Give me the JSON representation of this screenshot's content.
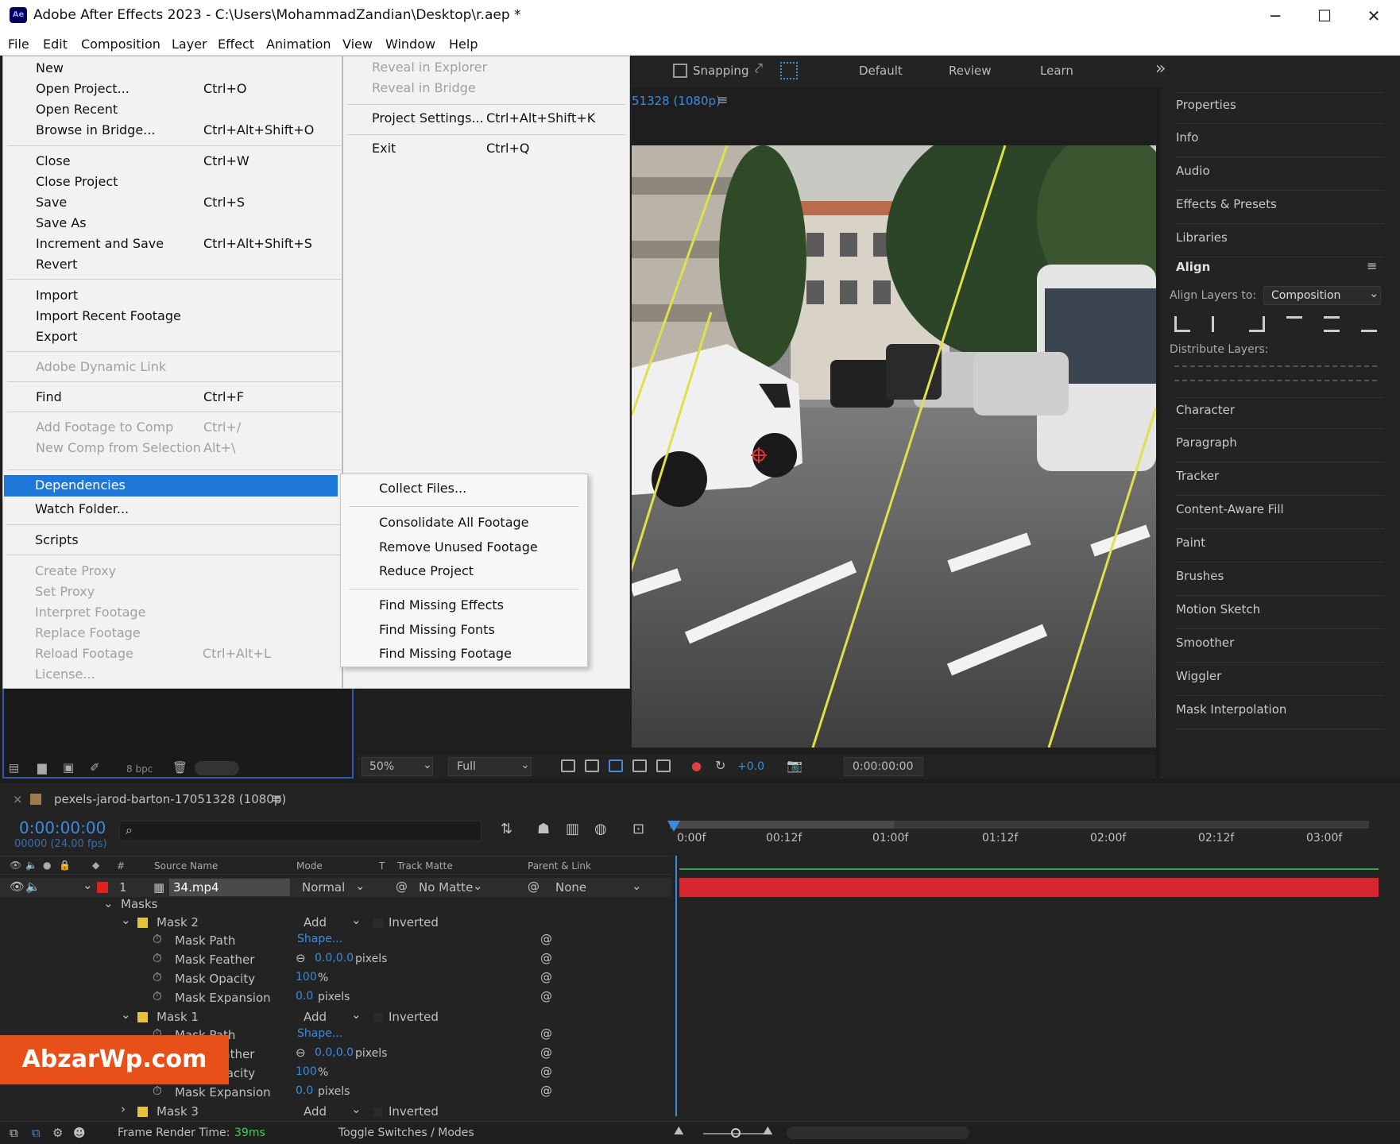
{
  "window": {
    "title": "Adobe After Effects 2023 - C:\\Users\\MohammadZandian\\Desktop\\r.aep *",
    "app_icon": "Ae",
    "minimize": "─",
    "maximize": "☐",
    "close": "✕"
  },
  "menubar": [
    "File",
    "Edit",
    "Composition",
    "Layer",
    "Effect",
    "Animation",
    "View",
    "Window",
    "Help"
  ],
  "file_menu": {
    "items": [
      {
        "label": "New",
        "shortcut": ""
      },
      {
        "label": "Open Project...",
        "shortcut": "Ctrl+O"
      },
      {
        "label": "Open Recent",
        "shortcut": ""
      },
      {
        "label": "Browse in Bridge...",
        "shortcut": "Ctrl+Alt+Shift+O"
      },
      {
        "label": "Close",
        "shortcut": "Ctrl+W"
      },
      {
        "label": "Close Project",
        "shortcut": ""
      },
      {
        "label": "Save",
        "shortcut": "Ctrl+S"
      },
      {
        "label": "Save As",
        "shortcut": ""
      },
      {
        "label": "Increment and Save",
        "shortcut": "Ctrl+Alt+Shift+S"
      },
      {
        "label": "Revert",
        "shortcut": ""
      },
      {
        "label": "Import",
        "shortcut": ""
      },
      {
        "label": "Import Recent Footage",
        "shortcut": ""
      },
      {
        "label": "Export",
        "shortcut": ""
      },
      {
        "label": "Adobe Dynamic Link",
        "shortcut": ""
      },
      {
        "label": "Find",
        "shortcut": "Ctrl+F"
      },
      {
        "label": "Add Footage to Comp",
        "shortcut": "Ctrl+/"
      },
      {
        "label": "New Comp from Selection",
        "shortcut": "Alt+\\"
      },
      {
        "label": "Dependencies",
        "shortcut": ""
      },
      {
        "label": "Watch Folder...",
        "shortcut": ""
      },
      {
        "label": "Scripts",
        "shortcut": ""
      },
      {
        "label": "Create Proxy",
        "shortcut": ""
      },
      {
        "label": "Set Proxy",
        "shortcut": ""
      },
      {
        "label": "Interpret Footage",
        "shortcut": ""
      },
      {
        "label": "Replace Footage",
        "shortcut": ""
      },
      {
        "label": "Reload Footage",
        "shortcut": "Ctrl+Alt+L"
      },
      {
        "label": "License...",
        "shortcut": ""
      }
    ],
    "col2": [
      {
        "label": "Reveal in Explorer",
        "shortcut": ""
      },
      {
        "label": "Reveal in Bridge",
        "shortcut": ""
      },
      {
        "label": "Project Settings...",
        "shortcut": "Ctrl+Alt+Shift+K"
      },
      {
        "label": "Exit",
        "shortcut": "Ctrl+Q"
      }
    ]
  },
  "dependencies_submenu": [
    "Collect Files...",
    "Consolidate All Footage",
    "Remove Unused Footage",
    "Reduce Project",
    "Find Missing Effects",
    "Find Missing Fonts",
    "Find Missing Footage"
  ],
  "toolbar": {
    "snapping": "Snapping",
    "workspaces": [
      "Default",
      "Review",
      "Learn"
    ],
    "more": "»"
  },
  "composition": {
    "tab_partial": "51328 (1080p)",
    "zoom": "50%",
    "resolution": "Full",
    "exposure": "+0.0",
    "timecode": "0:00:00:00"
  },
  "right_panels": [
    "Properties",
    "Info",
    "Audio",
    "Effects & Presets",
    "Libraries"
  ],
  "align": {
    "title": "Align",
    "align_to_label": "Align Layers to:",
    "align_to_value": "Composition",
    "distribute_label": "Distribute Layers:"
  },
  "right_panels_2": [
    "Character",
    "Paragraph",
    "Tracker",
    "Content-Aware Fill",
    "Paint",
    "Brushes",
    "Motion Sketch",
    "Smoother",
    "Wiggler",
    "Mask Interpolation"
  ],
  "project_panel": {
    "bpc": "8 bpc"
  },
  "timeline": {
    "comp_name": "pexels-jarod-barton-17051328 (1080p)",
    "timecode": "0:00:00:00",
    "frames": "00000 (24.00 fps)",
    "search_glyph": "⌕",
    "col_headers": {
      "num": "#",
      "source": "Source Name",
      "mode": "Mode",
      "t": "T",
      "track_matte": "Track Matte",
      "parent": "Parent & Link"
    },
    "ruler": [
      "0:00f",
      "00:12f",
      "01:00f",
      "01:12f",
      "02:00f",
      "02:12f",
      "03:00f"
    ],
    "layer": {
      "num": "1",
      "name": "34.mp4",
      "mode": "Normal",
      "matte": "No Matte",
      "parent": "None"
    },
    "masks_label": "Masks",
    "mask2": {
      "name": "Mask 2",
      "mode": "Add",
      "inverted": "Inverted",
      "path_label": "Mask Path",
      "path_value": "Shape...",
      "feather_label": "Mask Feather",
      "feather_value": "0.0,0.0",
      "feather_unit": "pixels",
      "opacity_label": "Mask Opacity",
      "opacity_value": "100",
      "opacity_unit": "%",
      "expansion_label": "Mask Expansion",
      "expansion_value": "0.0",
      "expansion_unit": "pixels"
    },
    "mask1": {
      "name": "Mask 1",
      "mode": "Add",
      "inverted": "Inverted",
      "path_label": "Mask Path",
      "path_value": "Shape...",
      "feather_label": "Mask Feather",
      "feather_value": "0.0,0.0",
      "feather_unit": "pixels",
      "opacity_label": "Mask Opacity",
      "opacity_value": "100",
      "opacity_unit": "%",
      "expansion_label": "Mask Expansion",
      "expansion_value": "0.0",
      "expansion_unit": "pixels"
    },
    "mask3": {
      "name": "Mask 3",
      "mode": "Add",
      "inverted": "Inverted"
    },
    "footer": {
      "render_label": "Frame Render Time:",
      "render_value": "39ms",
      "toggle": "Toggle Switches / Modes"
    }
  },
  "watermark": "AbzarWp.com",
  "colors": {
    "accent": "#1e78d7",
    "layer_bar": "#d8252f",
    "timecode": "#3b8be0",
    "watermark": "#e8501a"
  }
}
